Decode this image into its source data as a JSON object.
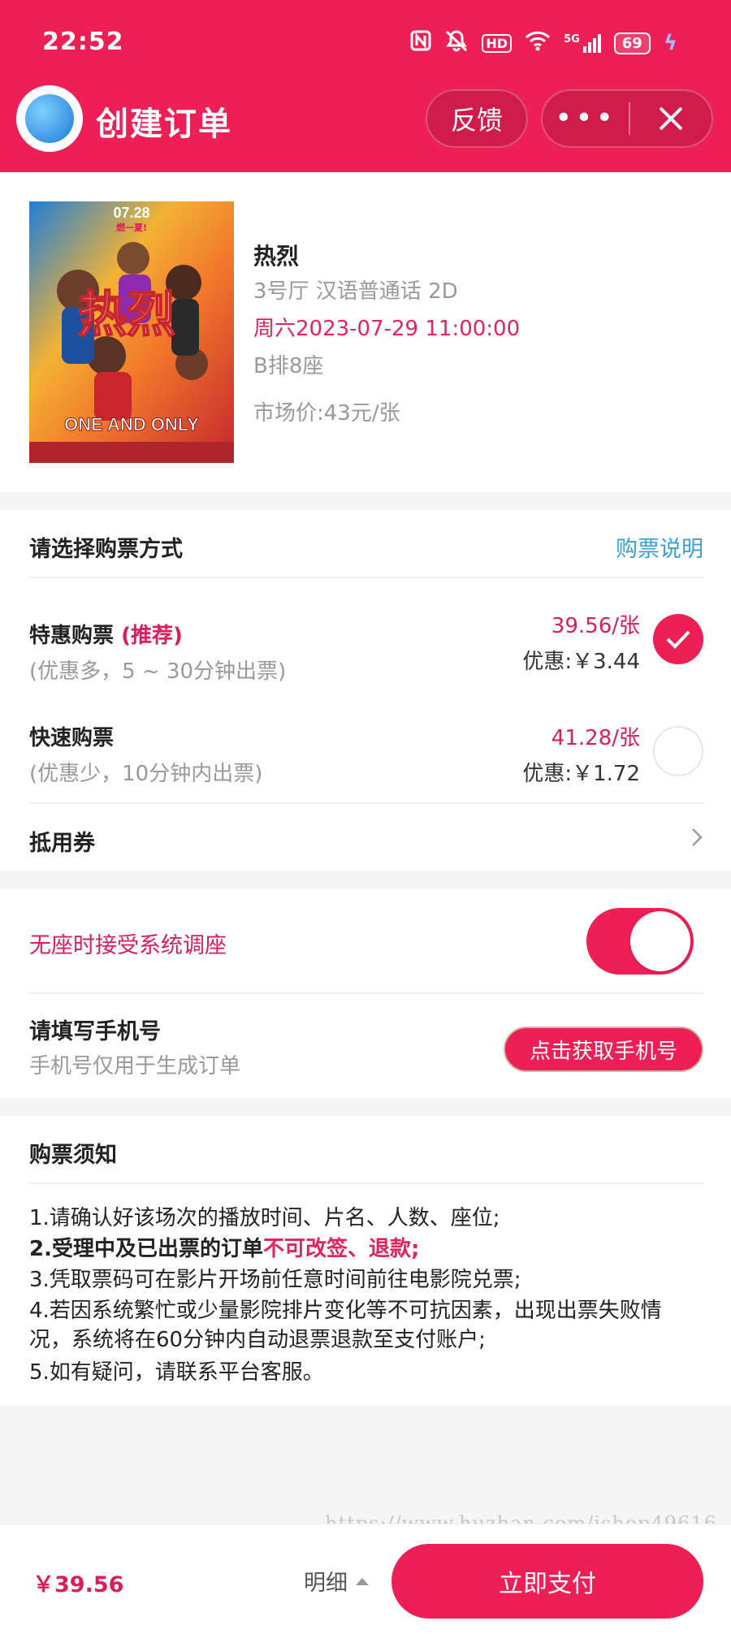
{
  "status_bar": {
    "time": "22:52",
    "icons": [
      "nfc-icon",
      "mute-icon",
      "hd-icon",
      "wifi-icon",
      "signal-5g-icon"
    ],
    "hd_label": "HD",
    "network_label": "5G",
    "battery": "69"
  },
  "header": {
    "title": "创建订单",
    "feedback_label": "反馈",
    "more_label": "•••",
    "close_icon": "close-icon"
  },
  "movie": {
    "title": "热烈",
    "hall": "3号厅 汉语普通话 2D",
    "showtime": "周六2023-07-29 11:00:00",
    "seat": "B排8座",
    "market_price": "市场价:43元/张",
    "poster": {
      "date_text": "07.28",
      "tagline": "燃一夏!",
      "title_art": "热烈",
      "english": "ONE AND ONLY"
    }
  },
  "purchase": {
    "section_title": "请选择购票方式",
    "help_link": "购票说明",
    "options": [
      {
        "name": "特惠购票",
        "badge": "(推荐)",
        "desc": "(优惠多，5 ~ 30分钟出票)",
        "price": "39.56/张",
        "discount": "优惠:￥3.44",
        "selected": true
      },
      {
        "name": "快速购票",
        "badge": "",
        "desc": "(优惠少，10分钟内出票)",
        "price": "41.28/张",
        "discount": "优惠:￥1.72",
        "selected": false
      }
    ],
    "coupon_label": "抵用券"
  },
  "seat_settings": {
    "auto_adjust_label": "无座时接受系统调座",
    "auto_adjust_on": true,
    "phone_label": "请填写手机号",
    "phone_hint": "手机号仅用于生成订单",
    "phone_button": "点击获取手机号"
  },
  "notice": {
    "title": "购票须知",
    "line1": "1.请确认好该场次的播放时间、片名、人数、座位;",
    "line2_prefix": "2.受理中及已出票的订单",
    "line2_highlight": "不可改签、退款;",
    "line3": "3.凭取票码可在影片开场前任意时间前往电影院兑票;",
    "line4": "4.若因系统繁忙或少量影院排片变化等不可抗因素，出现出票失败情况，系统将在60分钟内自动退票退款至支付账户;",
    "line5": "5.如有疑问，请联系平台客服。"
  },
  "watermark": "https://www.huzhan.com/ishop49616",
  "footer": {
    "total": "￥39.56",
    "detail_label": "明细",
    "pay_label": "立即支付"
  },
  "colors": {
    "brand": "#ee1f55",
    "accent_text": "#d81e5b",
    "link": "#3aa0d3"
  }
}
